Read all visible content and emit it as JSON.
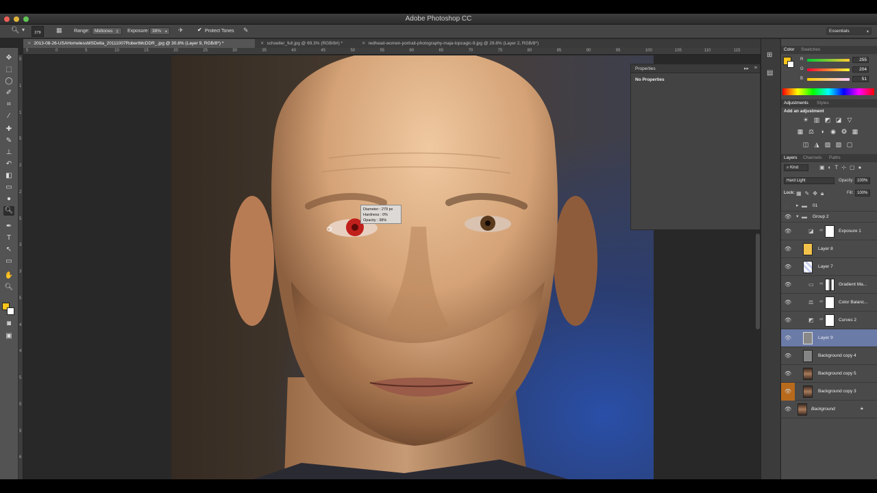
{
  "window": {
    "title": "Adobe Photoshop CC"
  },
  "options_bar": {
    "brush_size": "279",
    "range_label": "Range:",
    "range_value": "Midtones",
    "exposure_label": "Exposure:",
    "exposure_value": "38%",
    "protect_tones": "Protect Tones",
    "workspace": "Essentials"
  },
  "tabs": [
    {
      "label": "2013-08-26-USAHomelessMSDelta_20111007RobertMcDDR_.jpg @ 30.8% (Layer 9, RGB/8*) *"
    },
    {
      "label": "schoeller_full.jpg @ 69.3% (RGB/8#) *"
    },
    {
      "label": "redhead-women-portrait-photography-maja-topcagic-9.jpg @ 29.8% (Layer 2, RGB/8*)"
    }
  ],
  "ruler_top": [
    "5",
    "0",
    "5",
    "10",
    "15",
    "20",
    "25",
    "30",
    "35",
    "40",
    "45",
    "50",
    "55",
    "60",
    "65",
    "70",
    "75",
    "80",
    "85",
    "90",
    "95",
    "100",
    "105",
    "110",
    "115"
  ],
  "ruler_left": [
    "5",
    "1",
    "1",
    "5",
    "2",
    "2",
    "5",
    "3",
    "3",
    "5",
    "4",
    "4",
    "5",
    "5",
    "5",
    "6"
  ],
  "brush_tooltip": {
    "diameter": "Diameter : 279 px",
    "hardness": "Hardness :      0%",
    "opacity": "Opacity :     38%"
  },
  "properties": {
    "title": "Properties",
    "body": "No Properties"
  },
  "color_panel": {
    "tab_color": "Color",
    "tab_swatches": "Swatches",
    "r_label": "R",
    "g_label": "G",
    "b_label": "B",
    "r": "255",
    "g": "204",
    "b": "51",
    "foreground": "#f9c51c"
  },
  "adjustments_panel": {
    "tab_adjustments": "Adjustments",
    "tab_styles": "Styles",
    "hint": "Add an adjustment"
  },
  "layers_panel": {
    "tab_layers": "Layers",
    "tab_channels": "Channels",
    "tab_paths": "Paths",
    "kind": "Kind",
    "blend_mode": "Hard Light",
    "opacity_label": "Opacity:",
    "opacity": "100%",
    "lock_label": "Lock:",
    "fill_label": "Fill:",
    "fill": "100%",
    "layers": [
      {
        "name": "01",
        "type": "group-collapsed"
      },
      {
        "name": "Group 2",
        "type": "group-open"
      },
      {
        "name": "Exposure 1",
        "type": "adjustment"
      },
      {
        "name": "Layer 8",
        "type": "pixel"
      },
      {
        "name": "Layer 7",
        "type": "pixel"
      },
      {
        "name": "Gradient Ma...",
        "type": "adjustment"
      },
      {
        "name": "Color Balanc...",
        "type": "adjustment"
      },
      {
        "name": "Curves 2",
        "type": "adjustment"
      },
      {
        "name": "Layer 9",
        "type": "pixel",
        "selected": true
      },
      {
        "name": "Background copy 4",
        "type": "pixel"
      },
      {
        "name": "Background copy 5",
        "type": "pixel"
      },
      {
        "name": "Background copy 3",
        "type": "pixel"
      },
      {
        "name": "Background",
        "type": "background"
      }
    ]
  }
}
